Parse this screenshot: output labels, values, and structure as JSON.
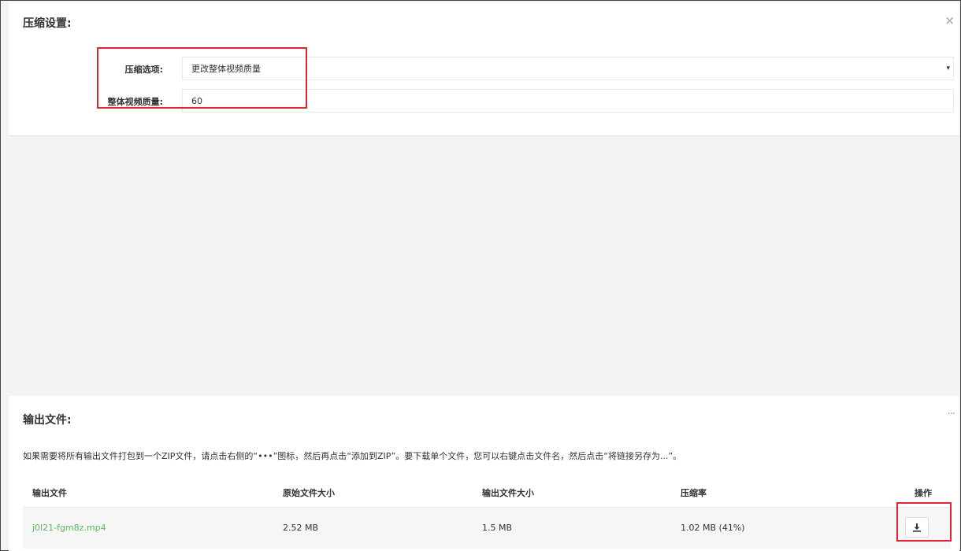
{
  "settings": {
    "title": "压缩设置:",
    "close_label": "×",
    "compression_option_label": "压缩选项:",
    "compression_option_value": "更改整体视频质量",
    "dropdown_caret": "▾",
    "quality_label": "整体视频质量:",
    "quality_value": "60"
  },
  "output": {
    "title": "输出文件:",
    "more_label": "···",
    "hint": "如果需要将所有输出文件打包到一个ZIP文件，请点击右侧的“•••”图标，然后再点击“添加到ZIP”。要下载单个文件，您可以右键点击文件名，然后点击“将链接另存为...”。",
    "columns": [
      "输出文件",
      "原始文件大小",
      "输出文件大小",
      "压缩率",
      "操作"
    ],
    "rows": [
      {
        "file": "j0l21-fgm8z.mp4",
        "original_size": "2.52 MB",
        "output_size": "1.5 MB",
        "ratio": "1.02 MB (41%)"
      }
    ]
  },
  "icons": {
    "close": "close-icon",
    "dropdown": "chevron-down-icon",
    "more": "more-icon",
    "download": "download-icon"
  },
  "colors": {
    "highlight_box": "#e0262e",
    "file_link": "#5cb85c"
  }
}
